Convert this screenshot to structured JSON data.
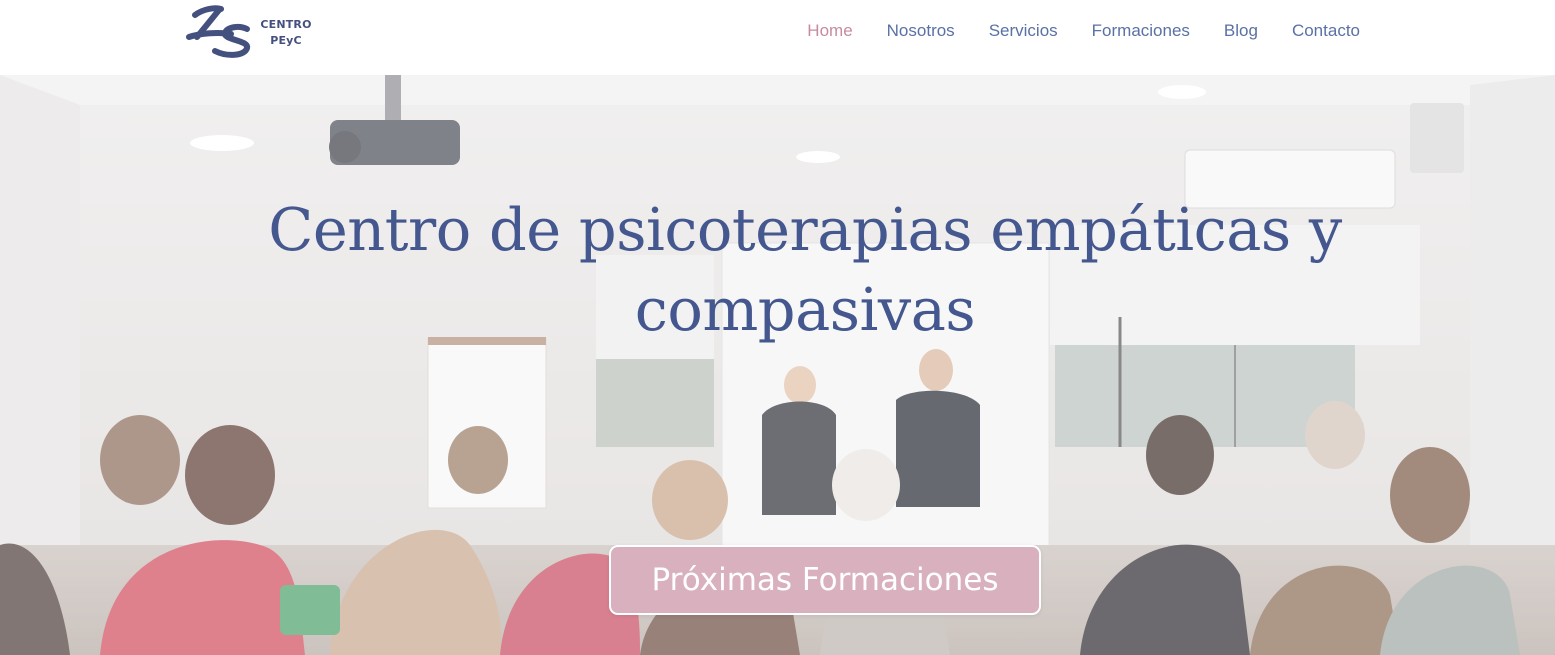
{
  "header": {
    "logo": {
      "line1": "CENTRO",
      "line2": "PEyC"
    },
    "nav": [
      {
        "label": "Home",
        "active": true
      },
      {
        "label": "Nosotros",
        "active": false
      },
      {
        "label": "Servicios",
        "active": false
      },
      {
        "label": "Formaciones",
        "active": false
      },
      {
        "label": "Blog",
        "active": false
      },
      {
        "label": "Contacto",
        "active": false
      }
    ]
  },
  "hero": {
    "title": "Centro de psicoterapias empáticas y compasivas",
    "cta_label": "Próximas Formaciones"
  },
  "colors": {
    "brand_blue": "#44588f",
    "nav_blue": "#5a71a6",
    "nav_active_pink": "#c68c9e",
    "cta_pink": "#d9b0bd"
  }
}
